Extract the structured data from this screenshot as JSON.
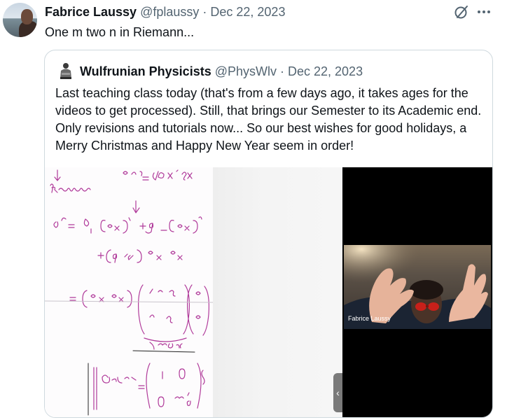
{
  "tweet": {
    "author_name": "Fabrice Laussy",
    "author_handle": "@fplaussy",
    "separator": "·",
    "date": "Dec 22, 2023",
    "text": "One m two n in Riemann..."
  },
  "icons": {
    "grok": "grok-slash-circle-icon",
    "more": "more-dots-icon"
  },
  "quoted": {
    "author_name": "Wulfrunian Physicists",
    "author_handle": "@PhysWlv",
    "separator": "·",
    "date": "Dec 22, 2023",
    "text": "Last teaching class today (that's from a few days ago, it takes ages for the videos to get processed). Still, that brings our Semester to its Academic end. Only revisions and tutorials now... So our best wishes for good holidays, a Merry Christmas and Happy New Year seem in order!",
    "media": {
      "video_participant": "Fabrice Laussy",
      "scroll_tab_glyph": "‹"
    }
  },
  "colors": {
    "text_primary": "#0f1419",
    "text_secondary": "#536471",
    "border": "#cfd9de",
    "ink": "#b03a9a"
  }
}
